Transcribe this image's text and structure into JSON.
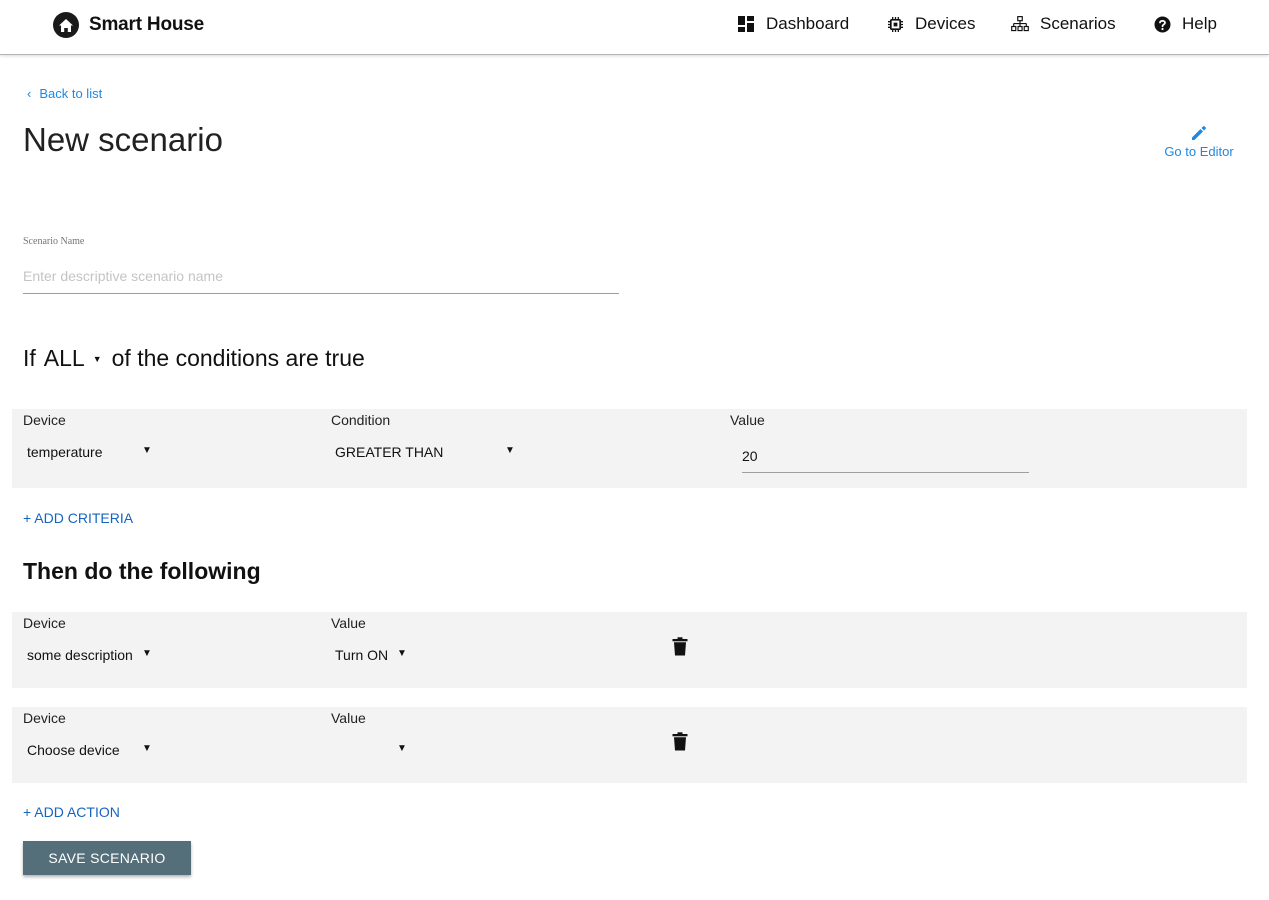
{
  "app": {
    "brand": "Smart House",
    "nav": [
      {
        "label": "Dashboard",
        "icon": "dashboard-icon"
      },
      {
        "label": "Devices",
        "icon": "chip-icon"
      },
      {
        "label": "Scenarios",
        "icon": "sitemap-icon"
      },
      {
        "label": "Help",
        "icon": "help-circle-icon"
      }
    ]
  },
  "header": {
    "back_label": "Back to list",
    "title": "New scenario",
    "editor_label": "Go to Editor"
  },
  "scenario_name": {
    "label": "Scenario Name",
    "placeholder": "Enter descriptive scenario name",
    "value": ""
  },
  "conditions": {
    "heading_prefix": "If",
    "quantifier": "ALL",
    "heading_suffix": "of the conditions are true",
    "columns": {
      "device": "Device",
      "condition": "Condition",
      "value": "Value"
    },
    "rows": [
      {
        "device": "temperature",
        "condition": "GREATER THAN",
        "value": "20"
      }
    ],
    "add_label": "+ ADD CRITERIA"
  },
  "actions": {
    "heading": "Then do the following",
    "columns": {
      "device": "Device",
      "value": "Value"
    },
    "rows": [
      {
        "device": "some description",
        "value": "Turn ON"
      },
      {
        "device": "Choose device",
        "value": ""
      }
    ],
    "add_label": "+ ADD ACTION"
  },
  "save_label": "SAVE SCENARIO",
  "colors": {
    "link": "#1e88e5",
    "add_link": "#1565c0",
    "save_button": "#546e7a",
    "row_background": "#f3f3f3"
  }
}
